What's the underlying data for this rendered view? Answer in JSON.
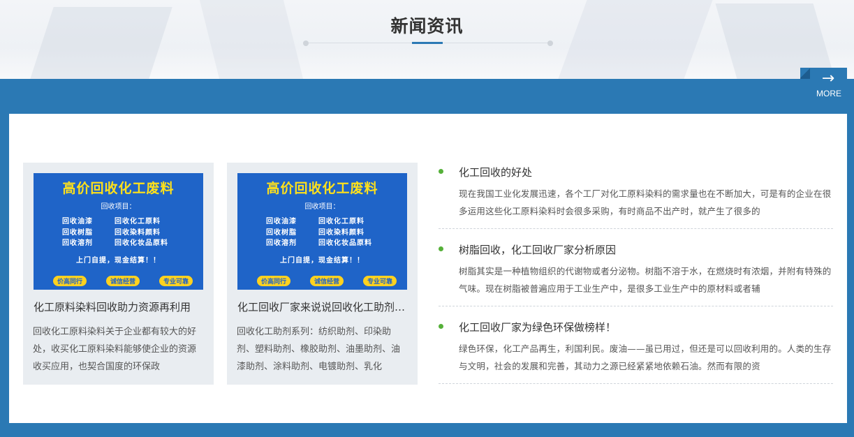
{
  "section": {
    "title": "新闻资讯",
    "more_label": "MORE",
    "more_arrow": "→"
  },
  "colors": {
    "brand_blue": "#2b79b4",
    "bullet_green": "#55b039",
    "thumb_blue": "#1f64c8",
    "thumb_yellow": "#ffe11a"
  },
  "thumbnail": {
    "headline": "高价回收化工废料",
    "subtitle": "回收项目：",
    "rows": [
      [
        "回收油漆",
        "回收化工原料"
      ],
      [
        "回收树脂",
        "回收染料颜料"
      ],
      [
        "回收溶剂",
        "回收化妆品原料"
      ]
    ],
    "note": "上门自提，现金结算！！",
    "badges": [
      "价高同行",
      "诚信经营",
      "专业可靠"
    ]
  },
  "cards": [
    {
      "title": "化工原料染料回收助力资源再利用",
      "desc": "回收化工原料染料关于企业都有较大的好处，收买化工原料染料能够使企业的资源收买应用，也契合国度的环保政"
    },
    {
      "title": "化工回收厂家来说说回收化工助剂系列",
      "desc": "回收化工助剂系列：纺织助剂、印染助剂、塑料助剂、橡胶助剂、油墨助剂、油漆助剂、涂料助剂、电镀助剂、乳化"
    }
  ],
  "news": [
    {
      "title": "化工回收的好处",
      "desc": "现在我国工业化发展迅速，各个工厂对化工原料染料的需求量也在不断加大，可是有的企业在很多运用这些化工原料染料时会很多采购，有时商品不出产时，就产生了很多的"
    },
    {
      "title": "树脂回收，化工回收厂家分析原因",
      "desc": "树脂其实是一种植物组织的代谢物或者分泌物。树脂不溶于水，在燃烧时有浓烟，并附有特殊的气味。现在树脂被普遍应用于工业生产中，是很多工业生产中的原材料或者辅"
    },
    {
      "title": "化工回收厂家为绿色环保做榜样！",
      "desc": "绿色环保，化工产品再生，利国利民。废油——虽已用过，但还是可以回收利用的。人类的生存与文明，社会的发展和完善，其动力之源已经紧紧地依赖石油。然而有限的资"
    }
  ]
}
